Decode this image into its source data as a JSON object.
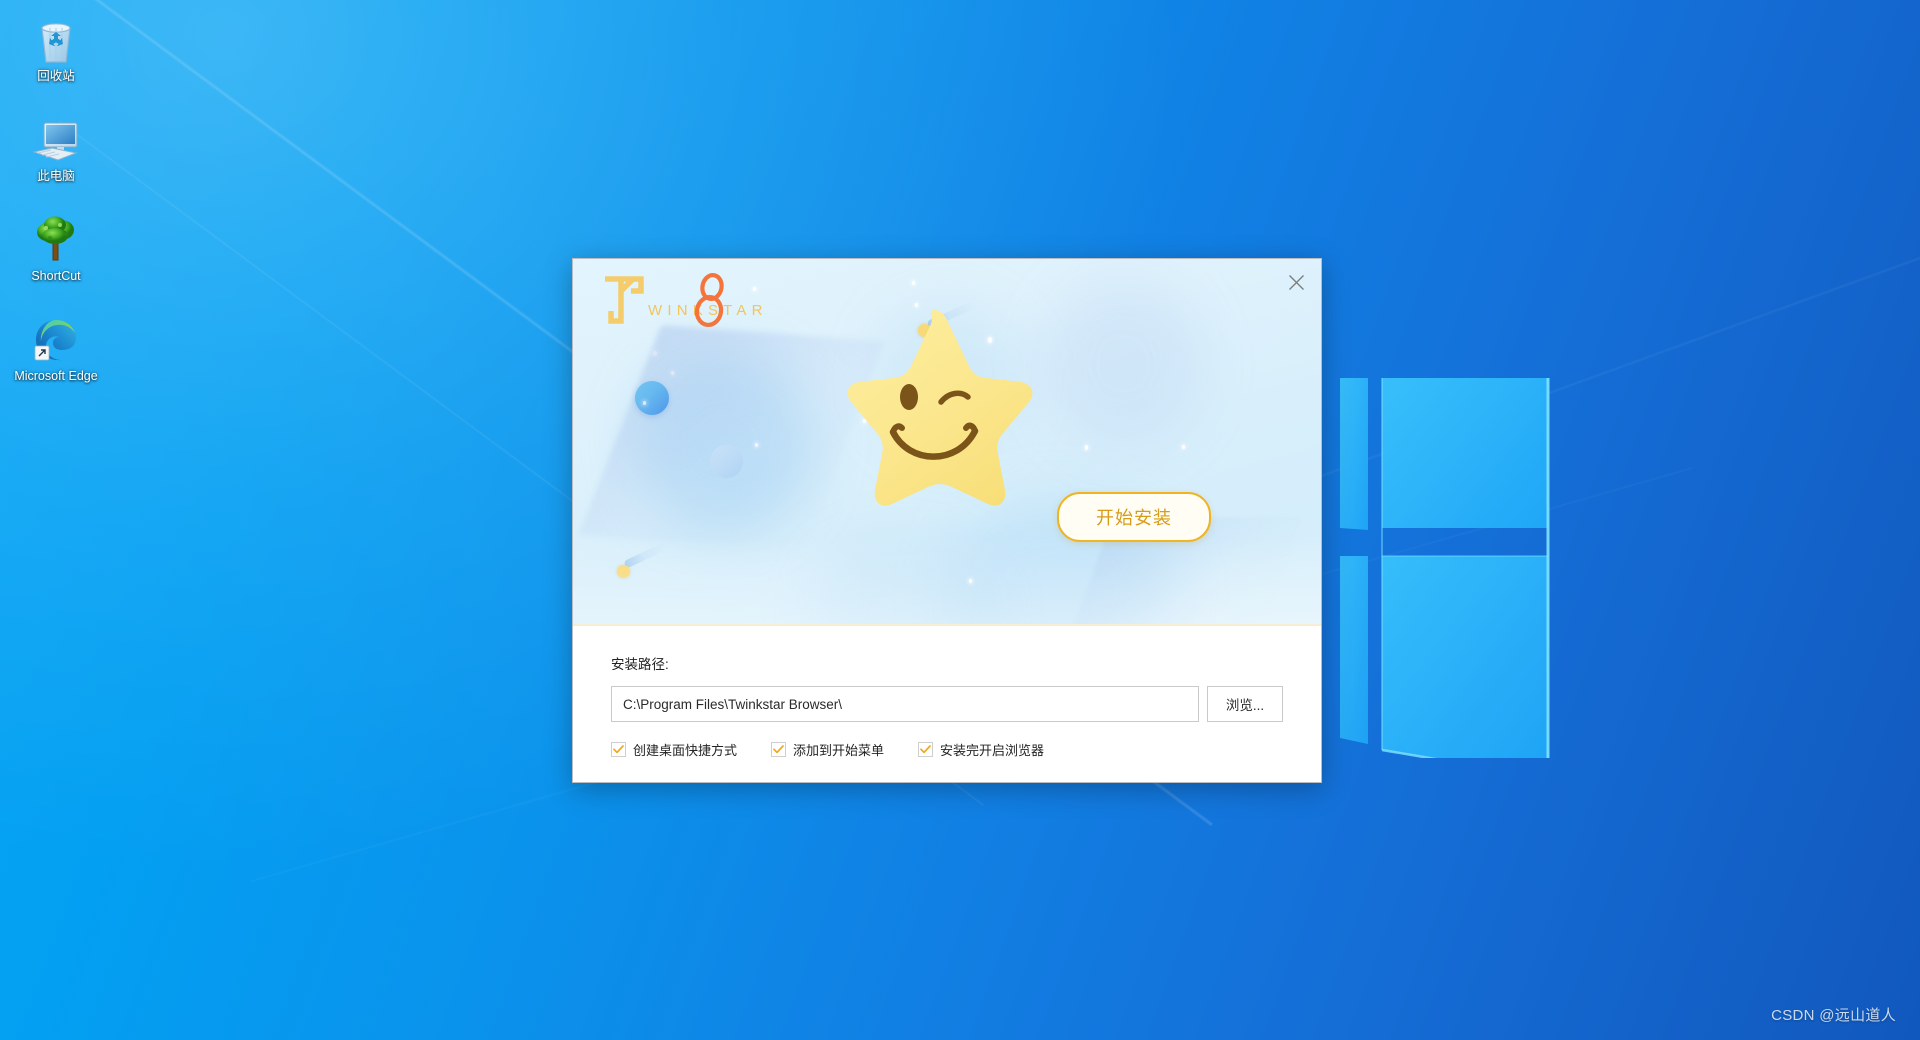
{
  "desktop": {
    "icons": [
      {
        "label": "回收站",
        "icon": "recycle-bin-icon"
      },
      {
        "label": "此电脑",
        "icon": "this-pc-icon"
      },
      {
        "label": "ShortCut",
        "icon": "tree-shortcut-icon"
      },
      {
        "label": "Microsoft Edge",
        "icon": "microsoft-edge-icon"
      }
    ],
    "wallpaper_logo": "windows-logo",
    "watermark": "CSDN @远山道人"
  },
  "installer": {
    "brand": {
      "wordmark": "WINKSTAR",
      "version_mark": "8",
      "mark_color": "#f5cc6b",
      "version_color": "#f4743b"
    },
    "close_label": "×",
    "hero": {
      "mascot": "winking-star-mascot",
      "install_button_label": "开始安装",
      "install_button_border_color": "#f0b323",
      "install_button_text_color": "#d79c18"
    },
    "form": {
      "path_label": "安装路径:",
      "path_value": "C:\\Program Files\\Twinkstar Browser\\",
      "path_placeholder": "C:\\Program Files\\Twinkstar Browser\\",
      "browse_label": "浏览...",
      "options": [
        {
          "label": "创建桌面快捷方式",
          "checked": true
        },
        {
          "label": "添加到开始菜单",
          "checked": true
        },
        {
          "label": "安装完开启浏览器",
          "checked": true
        }
      ],
      "check_color": "#f0a81e"
    }
  }
}
